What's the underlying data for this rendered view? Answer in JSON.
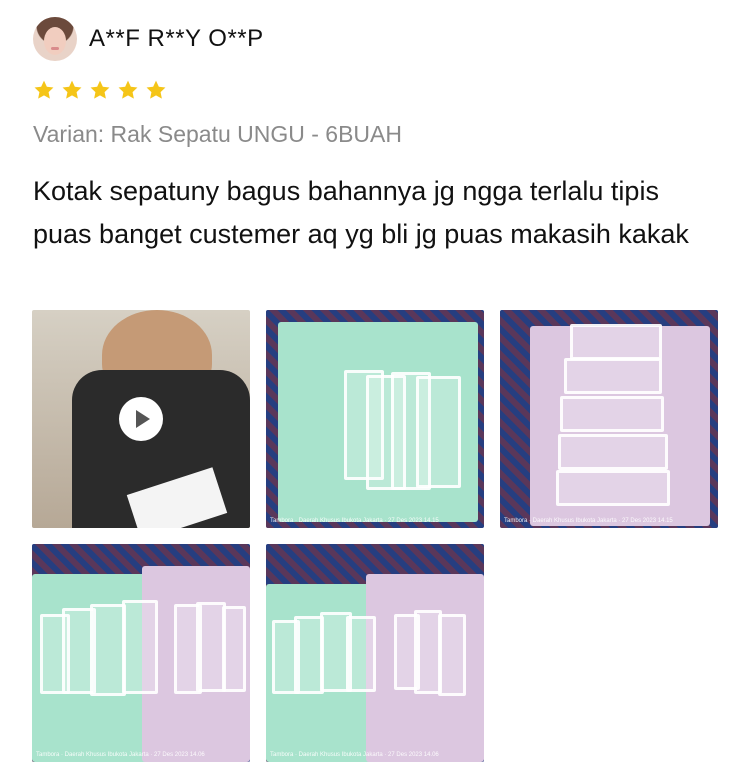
{
  "review": {
    "username": "A**F R**Y O**P",
    "rating": 5,
    "variant": "Varian: Rak Sepatu UNGU - 6BUAH",
    "text": "Kotak sepatuny bagus bahannya jg ngga terlalu tipis puas banget custemer aq yg bli jg puas makasih kakak",
    "star_color": "#f5c518",
    "media": [
      {
        "type": "video",
        "icon": "play-icon"
      },
      {
        "type": "image",
        "watermark": "Tambora · Daerah Khusus Ibukota Jakarta · 27 Des 2023 14.15"
      },
      {
        "type": "image",
        "watermark": "Tambora · Daerah Khusus Ibukota Jakarta · 27 Des 2023 14.15"
      },
      {
        "type": "image",
        "watermark": "Tambora · Daerah Khusus Ibukota Jakarta · 27 Des 2023 14.06"
      },
      {
        "type": "image",
        "watermark": "Tambora · Daerah Khusus Ibukota Jakarta · 27 Des 2023 14.06"
      }
    ]
  }
}
